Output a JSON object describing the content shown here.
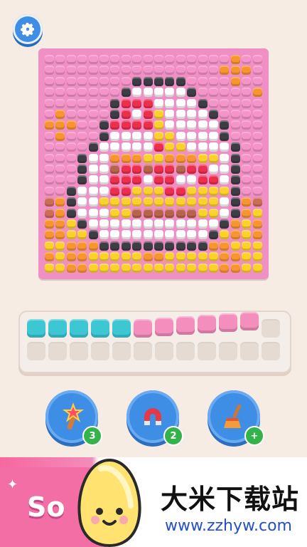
{
  "header": {
    "settings_icon": "gear-icon"
  },
  "board": {
    "grid_size": 20,
    "palette": {
      "P": "#f494c8",
      "O": "#f7962f",
      "B": "#3d3d45",
      "W": "#ffffff",
      "Y": "#fcd22a",
      "R": "#ec2f4d",
      "K": "#fb7ea8",
      "N": "#b8644a",
      "A": "#cc6d55",
      "D": "#ef5f86"
    },
    "rows": [
      "PPPPPPPPPPPPPPPPPOPP",
      "PPPPPPPPPPPPPPPPOOOP",
      "PPPPPPPPBBBBBPPPPOPP",
      "PPPPPPPBWWWWWBPPPPPO",
      "PPPPPPBRRRWWWWBPPPPP",
      "POPPPPBRWRYWWWWBPPPP",
      "OOOPPBRRRRYWWWWWBPPP",
      "POPPPBWWWWYYWWWWBPPP",
      "PPPPBWWWWWRYYWWWWBPP",
      "PPPBWWOOOYYOOOYYWBPP",
      "PPPBWWNRRNRRNRRWWBPP",
      "PPPBWWRRRWRRWWRRWBPP",
      "PPBWWWRRYYYRRYYYYBPP",
      "AOBWWYYYYYYYYYYYWBOA",
      "AOBWWWYYNNNNNNYYWBOY",
      "OOYBWWWWWWWWWWWWBOYO",
      "OOYYBWWWWWWWWWWBYOYO",
      "YYOOOBBBBBBBBBBOOYYY",
      "OYOOYYYYYOOYYYYYOOYY",
      "YYOOYYYYYYYYYYYYOOYY"
    ]
  },
  "tray": {
    "columns": 12,
    "top_row": [
      "#3cc7d3",
      "#3cc7d3",
      "#3cc7d3",
      "#3cc7d3",
      "#3cc7d3",
      "#f48fbd",
      "#f48fbd",
      "#f48fbd",
      "#f48fbd",
      "#f48fbd",
      "#f48fbd",
      ""
    ],
    "bottom_row": [
      "",
      "",
      "",
      "",
      "",
      "",
      "",
      "",
      "",
      "",
      "",
      ""
    ],
    "queued": [
      0,
      0,
      0,
      0,
      0,
      0,
      1,
      2,
      3,
      4,
      5,
      6
    ]
  },
  "boosters": [
    {
      "name": "magic-wand",
      "icon": "wand-icon",
      "count": "3"
    },
    {
      "name": "magnet",
      "icon": "magnet-icon",
      "count": "2"
    },
    {
      "name": "broom",
      "icon": "broom-icon",
      "count": "+"
    }
  ],
  "promo": {
    "label": "So"
  },
  "watermark": {
    "title": "大米下载站",
    "url": "www.zzhyw.com"
  },
  "colors": {
    "accent_blue": "#3e8ee6",
    "badge_green": "#33b34a",
    "background": "#f6ece4"
  }
}
